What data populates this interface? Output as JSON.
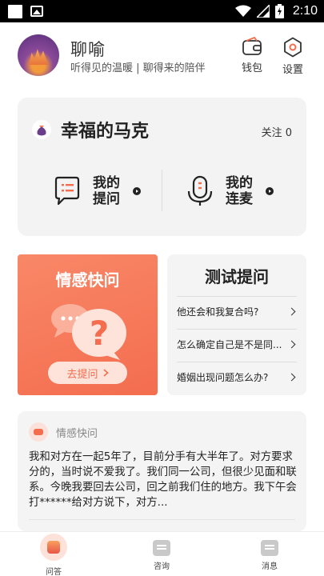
{
  "status_bar": {
    "time": "2:10"
  },
  "header": {
    "app_name": "聊喻",
    "slogan": "听得见的温暖 | 聊得来的陪伴",
    "wallet_label": "钱包",
    "settings_label": "设置"
  },
  "profile": {
    "name": "幸福的马克",
    "follow": "关注 0",
    "my_questions_label": "我的\n提问",
    "my_voice_label": "我的\n连麦"
  },
  "quick_card": {
    "title": "情感快问",
    "button_label": "去提问"
  },
  "test_card": {
    "title": "测试提问",
    "items": [
      "他还会和我复合吗?",
      "怎么确定自己是不是同...",
      "婚姻出现问题怎么办?"
    ]
  },
  "post": {
    "category": "情感快问",
    "text": "我和对方在一起5年了，目前分手有大半年了。对方要求分的，当时说不爱我了。我们同一公司，但很少见面和联系。今晚我要回去公司，回之前我们住的地方。我下午会打******给对方说下，对方..."
  },
  "tabs": [
    {
      "label": "问答",
      "active": true
    },
    {
      "label": "咨询",
      "active": false
    },
    {
      "label": "消息",
      "active": false
    }
  ],
  "colors": {
    "accent": "#f46d4f",
    "card_bg": "#f3f3f3",
    "status_bar": "#000000"
  }
}
